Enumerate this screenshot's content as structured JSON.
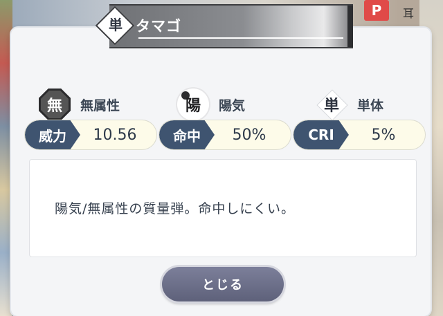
{
  "banner": {
    "type_kanji": "単",
    "title": "タマゴ"
  },
  "attributes": [
    {
      "icon": "mu-attribute-icon",
      "icon_char": "無",
      "label": "無属性"
    },
    {
      "icon": "yang-icon",
      "icon_char": "陽",
      "label": "陽気"
    },
    {
      "icon": "single-target-icon",
      "icon_char": "単",
      "label": "単体"
    }
  ],
  "stats": [
    {
      "label": "威力",
      "value": "10.56"
    },
    {
      "label": "命中",
      "value": "50%"
    },
    {
      "label": "CRI",
      "value": "5%"
    }
  ],
  "description": "陽気/無属性の質量弾。命中しにくい。",
  "close_button": "とじる",
  "background": {
    "p_sign": "P",
    "kanji": "耳"
  },
  "colors": {
    "stat_label_bg": "#3f5470",
    "button_bg": "#6d7089",
    "panel_bg": "#f4f5f7"
  }
}
